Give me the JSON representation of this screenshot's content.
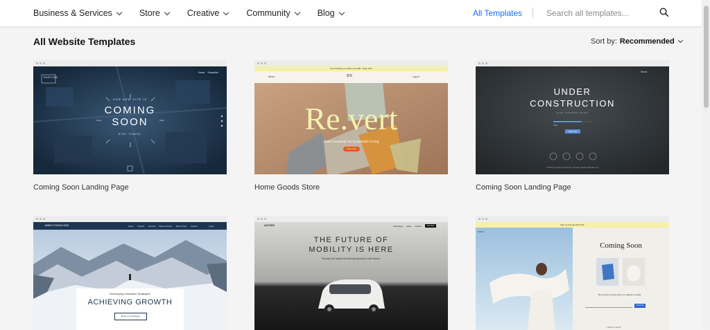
{
  "nav": {
    "items": [
      {
        "label": "Business & Services"
      },
      {
        "label": "Store"
      },
      {
        "label": "Creative"
      },
      {
        "label": "Community"
      },
      {
        "label": "Blog"
      }
    ],
    "all_templates": "All Templates",
    "search_placeholder": "Search all templates..."
  },
  "page": {
    "title": "All Website Templates",
    "sort_label": "Sort by:",
    "sort_value": "Recommended"
  },
  "cards": [
    {
      "title": "Coming Soon Landing Page",
      "shot": {
        "logo": "YOUR LOGO",
        "tagline": "OUR NEW SITE IS",
        "line1": "COMING",
        "line2": "SOON",
        "sub": "STAY TUNED!",
        "nav1": "Home",
        "nav2": "Subscribe"
      }
    },
    {
      "title": "Home Goods Store",
      "shot": {
        "brand": "Re.vert",
        "subtitle": "Home Essentials for Sustainable Living",
        "cta": "Shop Now",
        "logo": "RX",
        "menu": "Menu",
        "nav": "Log In",
        "banner": "Free shipping on orders over $50 · Shop Now"
      }
    },
    {
      "title": "Coming Soon Landing Page",
      "shot": {
        "line1": "UNDER",
        "line2": "CONSTRUCTION",
        "sub": "SITE COMING SOON",
        "pct": "75%",
        "button": "Notify Me",
        "footer": "© 2023 by Under Construction. Proudly created with Wix.com",
        "nav": "Home"
      }
    },
    {
      "title": "",
      "shot": {
        "brand": "JAMES CONSULTING",
        "small": "Developing Innovative Strategies",
        "headline": "ACHIEVING GROWTH",
        "button": "Book a Consultation",
        "nav": [
          "About",
          "Projects",
          "Services",
          "Plans & Pricing",
          "Book & Tips",
          "Contact"
        ],
        "login": "Log In"
      }
    },
    {
      "title": "",
      "shot": {
        "brand": "AUTORO",
        "line1": "THE FUTURE OF",
        "line2": "MOBILITY IS HERE",
        "sub": "Discover the safest self-driving experience with Autoro.",
        "nav": [
          "Technology",
          "About",
          "Contact"
        ],
        "cta": "Join Now"
      }
    },
    {
      "title": "",
      "shot": {
        "banner": "Sign up and get 10% OFF",
        "heading": "Coming Soon",
        "logo": "SORA",
        "text": "Be the first to know when our website is ready.",
        "button": "Subscribe",
        "footer": "© 2035 by SORA"
      }
    }
  ],
  "colors": {
    "accent": "#116dff",
    "navy": "#1c3550",
    "dark": "#2f3438"
  }
}
